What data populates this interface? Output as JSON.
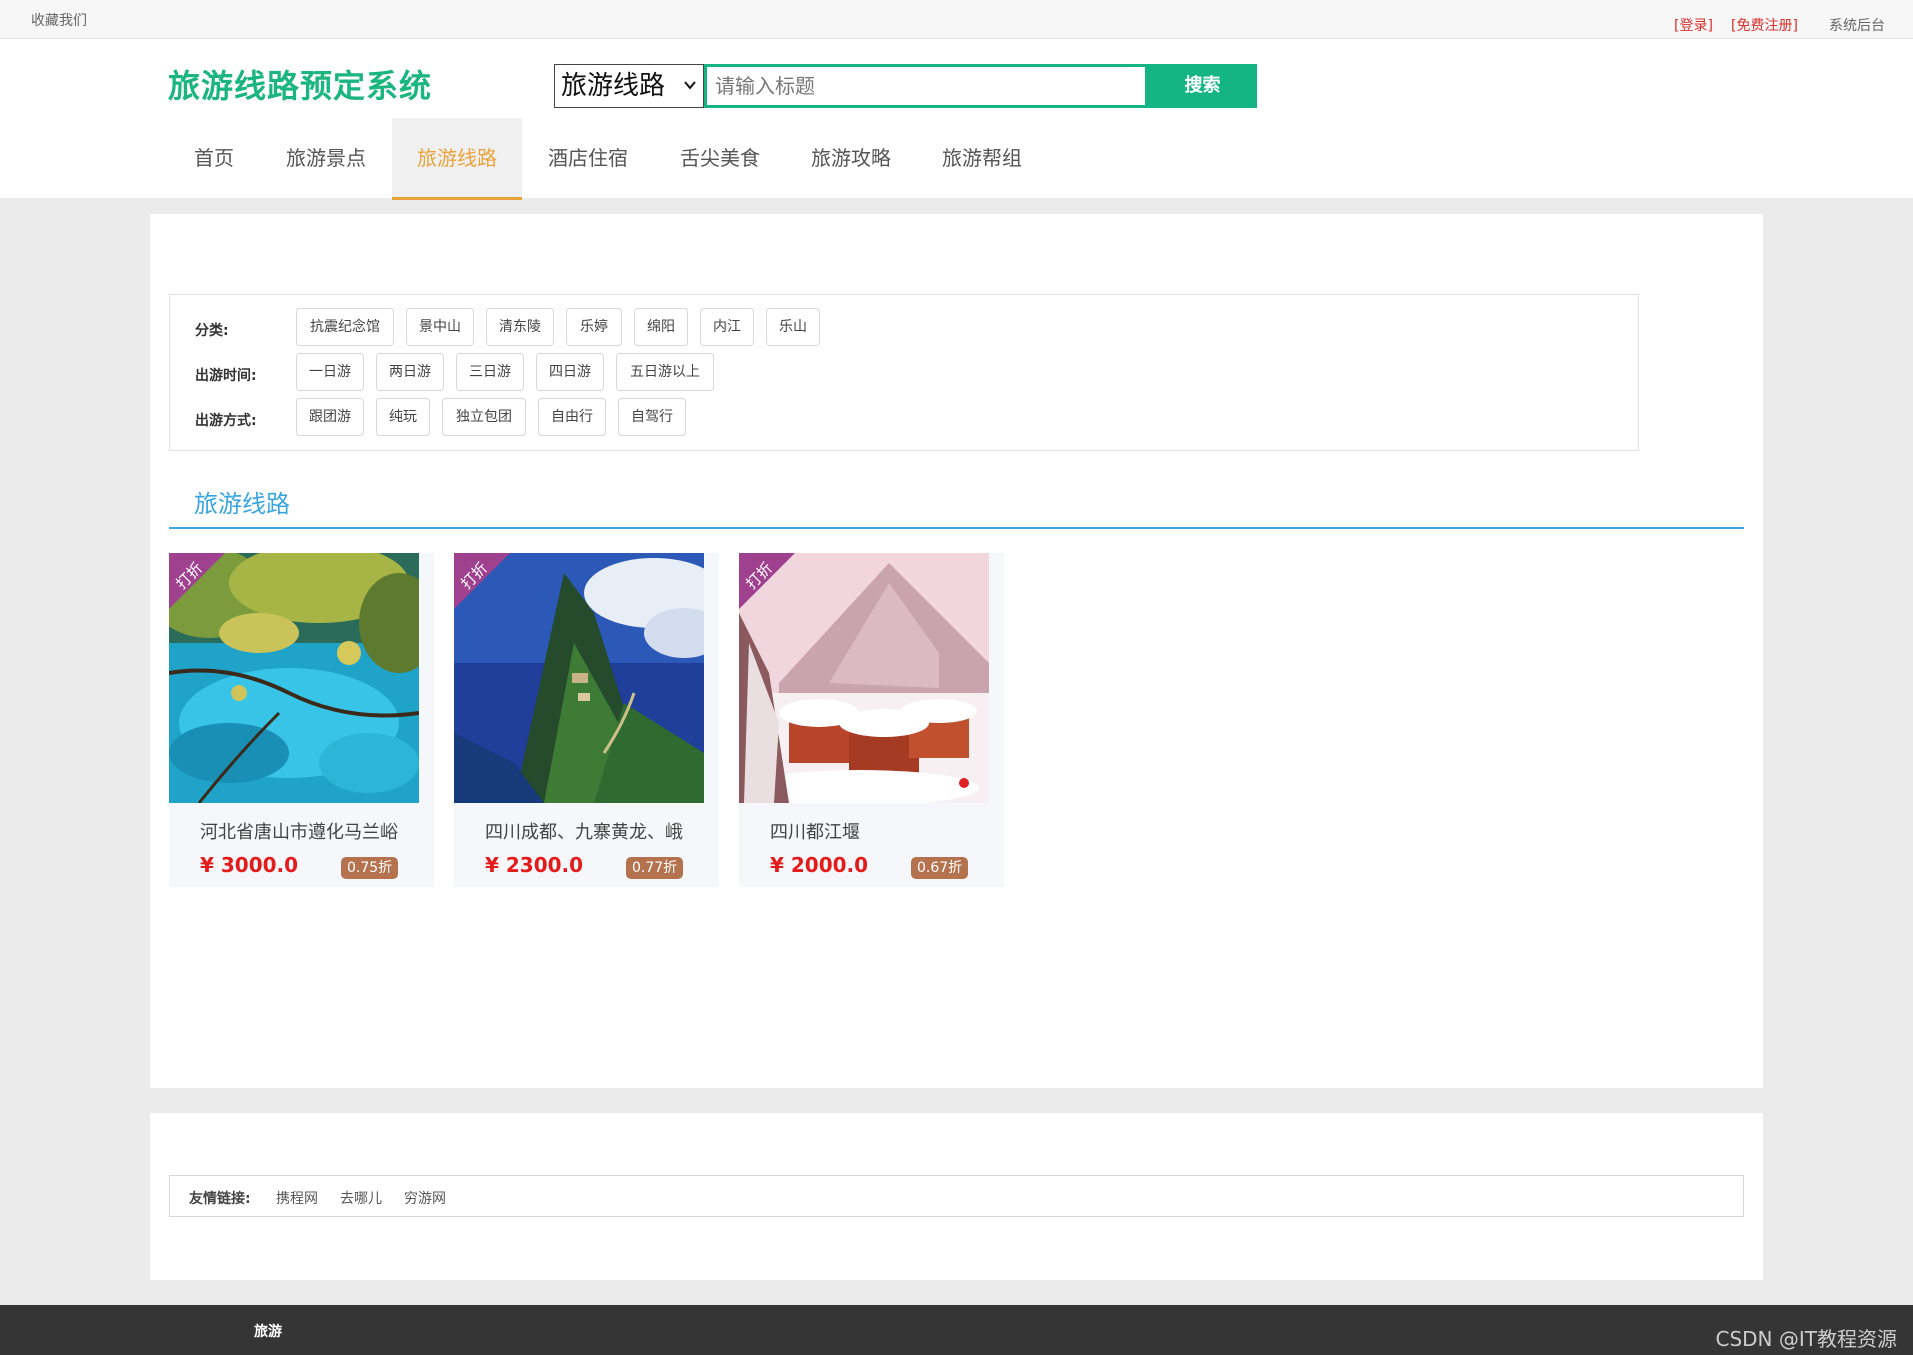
{
  "topbar": {
    "favorite": "收藏我们",
    "login": "[登录]",
    "register": "[免费注册]",
    "admin": "系统后台"
  },
  "header": {
    "logo": "旅游线路预定系统",
    "search": {
      "category_selected": "旅游线路",
      "placeholder": "请输入标题",
      "button": "搜索"
    }
  },
  "nav": {
    "items": [
      {
        "label": "首页"
      },
      {
        "label": "旅游景点"
      },
      {
        "label": "旅游线路",
        "active": true
      },
      {
        "label": "酒店住宿"
      },
      {
        "label": "舌尖美食"
      },
      {
        "label": "旅游攻略"
      },
      {
        "label": "旅游帮组"
      }
    ]
  },
  "filters": {
    "category": {
      "label": "分类:",
      "tags": [
        "抗震纪念馆",
        "景中山",
        "清东陵",
        "乐婷",
        "绵阳",
        "内江",
        "乐山"
      ]
    },
    "duration": {
      "label": "出游时间:",
      "tags": [
        "一日游",
        "两日游",
        "三日游",
        "四日游",
        "五日游以上"
      ]
    },
    "mode": {
      "label": "出游方式:",
      "tags": [
        "跟团游",
        "纯玩",
        "独立包团",
        "自由行",
        "自驾行"
      ]
    }
  },
  "section": {
    "title": "旅游线路"
  },
  "cards": [
    {
      "ribbon": "打折",
      "title": "河北省唐山市遵化马兰峪",
      "price": "¥ 3000.0",
      "discount": "0.75折",
      "image": "lake-forest"
    },
    {
      "ribbon": "打折",
      "title": "四川成都、九寨黄龙、峨",
      "price": "¥ 2300.0",
      "discount": "0.77折",
      "image": "mountain-peak"
    },
    {
      "ribbon": "打折",
      "title": "四川都江堰",
      "price": "¥ 2000.0",
      "discount": "0.67折",
      "image": "snow-village"
    }
  ],
  "friend_links": {
    "label": "友情链接:",
    "items": [
      "携程网",
      "去哪儿",
      "穷游网"
    ]
  },
  "footer": {
    "brand": "旅游",
    "watermark": "CSDN @IT教程资源"
  },
  "colors": {
    "brand_green": "#14b582",
    "nav_active": "#e8a33a",
    "section_blue": "#3aa6e0",
    "price_red": "#e41b1b",
    "ribbon_purple": "#a0418f",
    "discount_brown": "#b4734e"
  }
}
